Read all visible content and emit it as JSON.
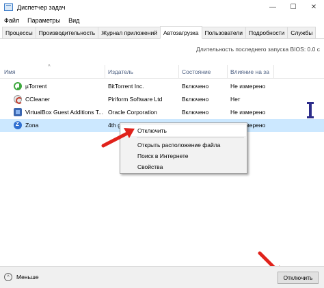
{
  "window": {
    "title": "Диспетчер задач",
    "minimize": "—",
    "maximize": "☐",
    "close": "✕"
  },
  "menu": [
    "Файл",
    "Параметры",
    "Вид"
  ],
  "tabs": [
    {
      "label": "Процессы",
      "active": false
    },
    {
      "label": "Производительность",
      "active": false
    },
    {
      "label": "Журнал приложений",
      "active": false
    },
    {
      "label": "Автозагрузка",
      "active": true
    },
    {
      "label": "Пользователи",
      "active": false
    },
    {
      "label": "Подробности",
      "active": false
    },
    {
      "label": "Службы",
      "active": false
    }
  ],
  "bios_info": "Длительность последнего запуска BIOS: 0.0 с",
  "columns": {
    "name": "Имя",
    "publisher": "Издатель",
    "status": "Состояние",
    "impact": "Влияние на за"
  },
  "rows": [
    {
      "icon": "utorrent-icon",
      "name": "µTorrent",
      "publisher": "BitTorrent Inc.",
      "status": "Включено",
      "impact": "Не измерено",
      "selected": false
    },
    {
      "icon": "ccleaner-icon",
      "name": "CCleaner",
      "publisher": "Piriform Software Ltd",
      "status": "Включено",
      "impact": "Нет",
      "selected": false
    },
    {
      "icon": "virtualbox-icon",
      "name": "VirtualBox Guest Additions T...",
      "publisher": "Oracle Corporation",
      "status": "Включено",
      "impact": "Не измерено",
      "selected": false
    },
    {
      "icon": "zona-icon",
      "name": "Zona",
      "publisher": "4th g",
      "status": "",
      "impact": "Не измерено",
      "selected": true
    }
  ],
  "context_menu": {
    "items": [
      "Отключить",
      "Открыть расположение файла",
      "Поиск в Интернете",
      "Свойства"
    ],
    "highlighted": "Отключить"
  },
  "footer": {
    "less_label": "Меньше",
    "less_icon": "chevron-up-icon",
    "disable_button": "Отключить"
  },
  "colors": {
    "selection": "#cce8ff",
    "header_text": "#4d6082",
    "annotation_arrow": "#e0221b"
  }
}
